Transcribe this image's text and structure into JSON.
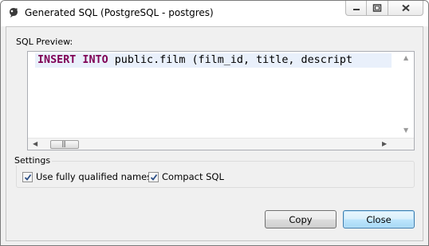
{
  "window": {
    "title": "Generated SQL (PostgreSQL - postgres)",
    "icon": "database-app-icon",
    "controls": [
      "minimize-icon",
      "restore-icon",
      "close-icon"
    ]
  },
  "sql_preview": {
    "label": "SQL Preview:",
    "code_keywords": "INSERT INTO",
    "code_rest": " public.film (film_id, title, descript"
  },
  "settings": {
    "legend": "Settings",
    "options": [
      {
        "label": "Use fully qualified names",
        "checked": true
      },
      {
        "label": "Compact SQL",
        "checked": true
      }
    ]
  },
  "buttons": {
    "copy": "Copy",
    "close": "Close"
  },
  "colors": {
    "keyword": "#7f0055",
    "current_line": "#e9f0fb",
    "default_button_border": "#3c7fb1"
  }
}
